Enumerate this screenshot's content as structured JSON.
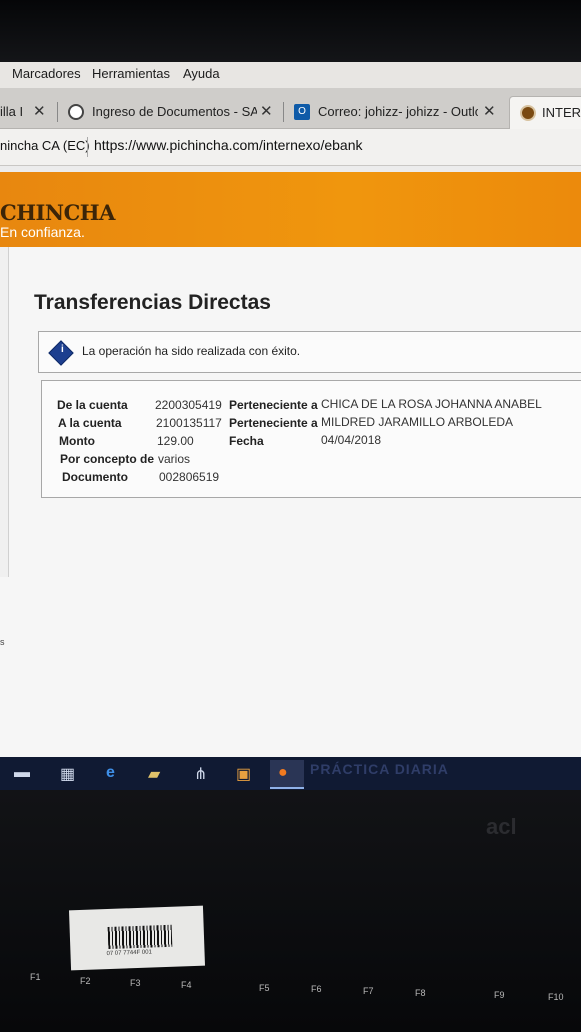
{
  "browser": {
    "menu": [
      "Marcadores",
      "Herramientas",
      "Ayuda"
    ],
    "tabs": [
      {
        "label": "illa I",
        "close": "✕"
      },
      {
        "label": "Ingreso de Documentos - SA",
        "close": "✕"
      },
      {
        "label": "Correo: johizz- johizz - Outlo",
        "close": "✕"
      },
      {
        "label": "INTERN"
      }
    ],
    "site_identity": "nincha CA (EC)",
    "url": "https://www.pichincha.com/internexo/ebank"
  },
  "bank": {
    "brand": "CHINCHA",
    "slogan": "En confianza.",
    "brand_color": "#f0960d"
  },
  "page": {
    "title": "Transferencias Directas",
    "message": "La operación ha sido realizada con éxito."
  },
  "details": {
    "from_label": "De la cuenta",
    "from_account": "2200305419",
    "from_owner_label": "Perteneciente a",
    "from_owner": "CHICA DE LA ROSA JOHANNA ANABEL",
    "to_label": "A la cuenta",
    "to_account": "2100135117",
    "to_owner_label": "Perteneciente a",
    "to_owner": "MILDRED JARAMILLO ARBOLEDA",
    "amount_label": "Monto",
    "amount": "129.00",
    "date_label": "Fecha",
    "date": "04/04/2018",
    "concept_label": "Por concepto de",
    "concept": "varios",
    "document_label": "Documento",
    "document": "002806519"
  },
  "left_crumbs": [
    "s"
  ],
  "taskbar": {
    "ghost_text": "PRÁCTICA DIARIA",
    "items": [
      "file-explorer-icon",
      "store-icon",
      "edge-icon",
      "folder-icon",
      "network-icon",
      "photos-icon",
      "firefox-icon"
    ]
  },
  "keyboard": {
    "function_keys": [
      "F1",
      "F2",
      "F3",
      "F4",
      "F5",
      "F6",
      "F7",
      "F8",
      "F9",
      "F10"
    ],
    "sticker_code": "07 07 7744F 001",
    "logo_text": "acl"
  }
}
